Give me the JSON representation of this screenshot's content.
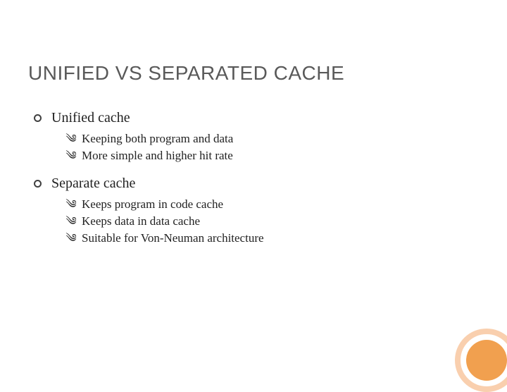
{
  "title": "UNIFIED VS SEPARATED CACHE",
  "sections": [
    {
      "heading": "Unified cache",
      "items": [
        "Keeping both program and data",
        "More simple and higher hit rate"
      ]
    },
    {
      "heading": "Separate cache",
      "items": [
        "Keeps program in code cache",
        "Keeps data in data cache",
        "Suitable for Von-Neuman architecture"
      ]
    }
  ],
  "bullet_glyph": "༄"
}
